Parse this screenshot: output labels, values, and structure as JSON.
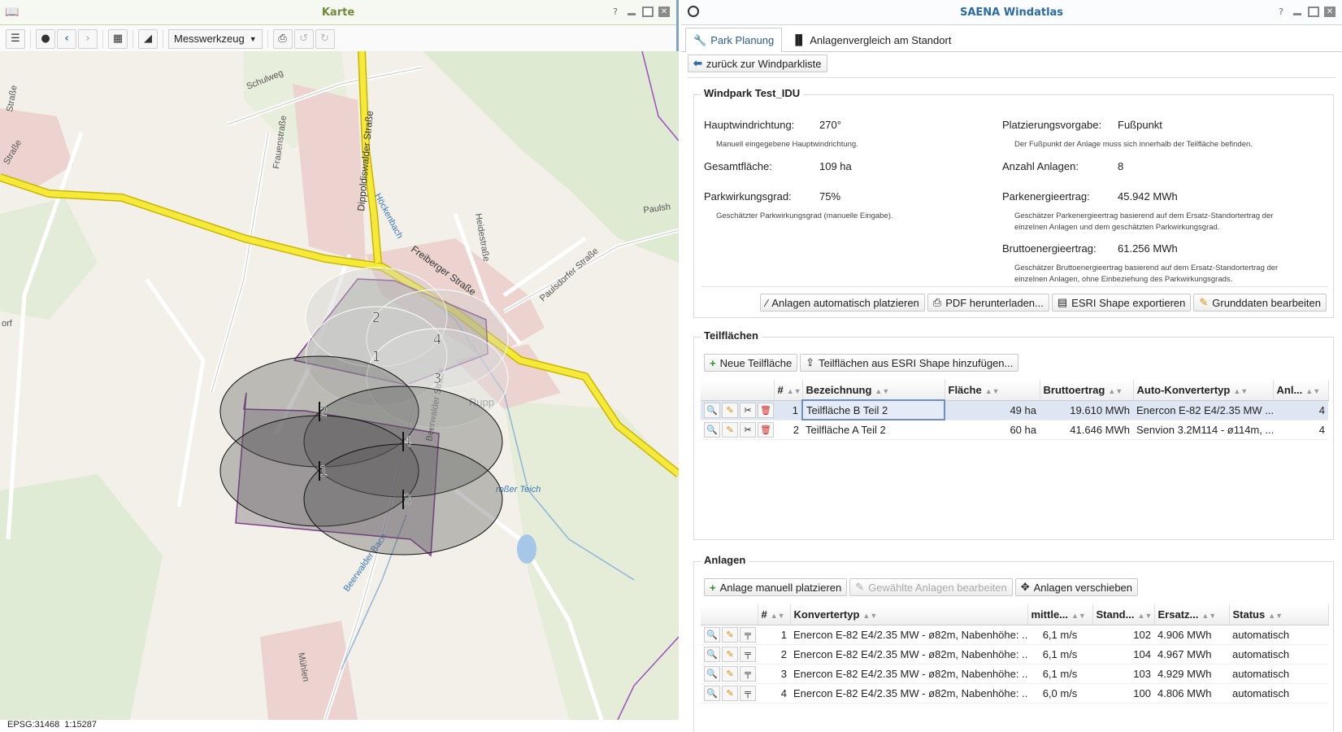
{
  "left": {
    "title": "Karte",
    "help": "?",
    "toolbar": {
      "measure_label": "Messwerkzeug"
    },
    "map_labels": {
      "schulweg": "Schulweg",
      "frauenstrasse": "Frauenstraße",
      "dippoldiswalder": "Dippoldiswalder Straße",
      "hockenbach": "Höckenbach",
      "freiberger": "Freiberger Straße",
      "heidestrasse": "Heidestraße",
      "paulsdorfer": "Paulsdorfer Straße",
      "paulsh": "Paulsh",
      "strasse_tl": "Straße",
      "strasse_tl2": "Straße",
      "orf": "orf",
      "rupp": "Rupp",
      "grosser_teich": "roßer Teich",
      "beerwalder_bach": "Beerwalder Bach",
      "beerwalder_strasse": "Beerwalder Straße",
      "muhlen": "Mühlen"
    },
    "turbine_labels": [
      "2",
      "4",
      "1",
      "3",
      "2",
      "4",
      "1",
      "3"
    ],
    "status": {
      "epsg": "EPSG:31468",
      "scale": "1:15287"
    }
  },
  "right": {
    "title": "SAENA Windatlas",
    "help": "?",
    "tabs": [
      {
        "label": "Park Planung",
        "icon": "wrench-icon"
      },
      {
        "label": "Anlagenvergleich am Standort",
        "icon": "bar-chart-icon"
      }
    ],
    "back_button": "zurück zur Windparkliste",
    "windpark": {
      "legend": "Windpark Test_IDU",
      "hauptwindrichtung_label": "Hauptwindrichtung:",
      "hauptwindrichtung_value": "270°",
      "hauptwindrichtung_hint": "Manuell eingegebene Hauptwindrichtung.",
      "gesamtflaeche_label": "Gesamtfläche:",
      "gesamtflaeche_value": "109 ha",
      "parkwirkungsgrad_label": "Parkwirkungsgrad:",
      "parkwirkungsgrad_value": "75%",
      "parkwirkungsgrad_hint": "Geschätzter Parkwirkungsgrad (manuelle Eingabe).",
      "platzierung_label": "Platzierungsvorgabe:",
      "platzierung_value": "Fußpunkt",
      "platzierung_hint": "Der Fußpunkt der Anlage muss sich innerhalb der Teilfläche befinden.",
      "anzahl_label": "Anzahl Anlagen:",
      "anzahl_value": "8",
      "parkenergie_label": "Parkenergieertrag:",
      "parkenergie_value": "45.942 MWh",
      "parkenergie_hint1": "Geschätzer Parkenergieertrag basierend auf dem Ersatz-Standortertrag der",
      "parkenergie_hint2": "einzelnen Anlagen und dem geschätzten Parkwirkungsgrad.",
      "brutto_label": "Bruttoenergieertrag:",
      "brutto_value": "61.256 MWh",
      "brutto_hint1": "Geschätzer Bruttoenergieertrag basierend auf dem Ersatz-Standortertrag der",
      "brutto_hint2": "einzelnen Anlagen, ohne Einbeziehung des Parkwirkungsgrads.",
      "buttons": {
        "auto_place": "Anlagen automatisch platzieren",
        "pdf": "PDF herunterladen...",
        "esri": "ESRI Shape exportieren",
        "grunddaten": "Grunddaten bearbeiten"
      }
    },
    "teilflaechen": {
      "legend": "Teilflächen",
      "new_button": "Neue Teilfläche",
      "import_button": "Teilflächen aus ESRI Shape hinzufügen...",
      "columns": [
        "#",
        "Bezeichnung",
        "Fläche",
        "Bruttoertrag",
        "Auto-Konvertertyp",
        "Anl..."
      ],
      "rows": [
        {
          "nr": "1",
          "name": "Teilfläche B Teil 2",
          "flaeche": "49 ha",
          "ertrag": "19.610 MWh",
          "typ": "Enercon E-82 E4/2.35 MW ...",
          "anl": "4"
        },
        {
          "nr": "2",
          "name": "Teilfläche A Teil 2",
          "flaeche": "60 ha",
          "ertrag": "41.646 MWh",
          "typ": "Senvion 3.2M114 - ø114m, ...",
          "anl": "4"
        }
      ]
    },
    "anlagen": {
      "legend": "Anlagen",
      "place_button": "Anlage manuell platzieren",
      "edit_button": "Gewählte Anlagen bearbeiten",
      "move_button": "Anlagen verschieben",
      "columns": [
        "#",
        "Konvertertyp",
        "mittle...",
        "Stand...",
        "Ersatz...",
        "Status"
      ],
      "rows": [
        {
          "nr": "1",
          "typ": "Enercon E-82 E4/2.35 MW - ø82m, Nabenhöhe: ...",
          "wind": "6,1 m/s",
          "stand": "102",
          "ersatz": "4.906 MWh",
          "status": "automatisch"
        },
        {
          "nr": "2",
          "typ": "Enercon E-82 E4/2.35 MW - ø82m, Nabenhöhe: ...",
          "wind": "6,1 m/s",
          "stand": "104",
          "ersatz": "4.967 MWh",
          "status": "automatisch"
        },
        {
          "nr": "3",
          "typ": "Enercon E-82 E4/2.35 MW - ø82m, Nabenhöhe: ...",
          "wind": "6,1 m/s",
          "stand": "103",
          "ersatz": "4.929 MWh",
          "status": "automatisch"
        },
        {
          "nr": "4",
          "typ": "Enercon E-82 E4/2.35 MW - ø82m, Nabenhöhe: ...",
          "wind": "6,0 m/s",
          "stand": "100",
          "ersatz": "4.806 MWh",
          "status": "automatisch"
        }
      ]
    }
  }
}
